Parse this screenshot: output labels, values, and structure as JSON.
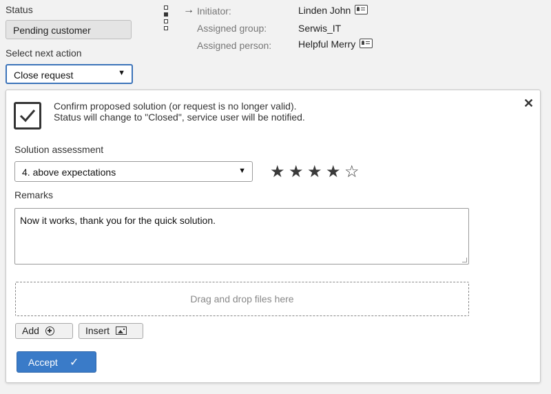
{
  "status": {
    "label": "Status",
    "value": "Pending customer"
  },
  "next_action": {
    "label": "Select next action",
    "value": "Close request"
  },
  "people": {
    "initiator_label": "Initiator:",
    "initiator_value": "Linden John",
    "group_label": "Assigned group:",
    "group_value": "Serwis_IT",
    "person_label": "Assigned person:",
    "person_value": "Helpful Merry"
  },
  "panel": {
    "desc_line1": "Confirm proposed solution (or request is no longer valid).",
    "desc_line2": "Status will change to \"Closed\", service user will be notified.",
    "assessment_label": "Solution assessment",
    "assessment_value": "4. above expectations",
    "rating": 4,
    "rating_max": 5,
    "remarks_label": "Remarks",
    "remarks_value": "Now it works, thank you for the quick solution.",
    "dropzone_text": "Drag and drop files here",
    "add_label": "Add",
    "insert_label": "Insert",
    "accept_label": "Accept"
  },
  "icons": {
    "close": "close-icon",
    "checkbox": "checkbox-icon",
    "plus": "plus-circle-icon",
    "image": "image-icon",
    "card": "contact-card-icon",
    "arrow": "arrow-right-icon",
    "accept_check": "checkmark-icon"
  },
  "colors": {
    "accent": "#3a7bc8",
    "select_border": "#3b73b9"
  }
}
